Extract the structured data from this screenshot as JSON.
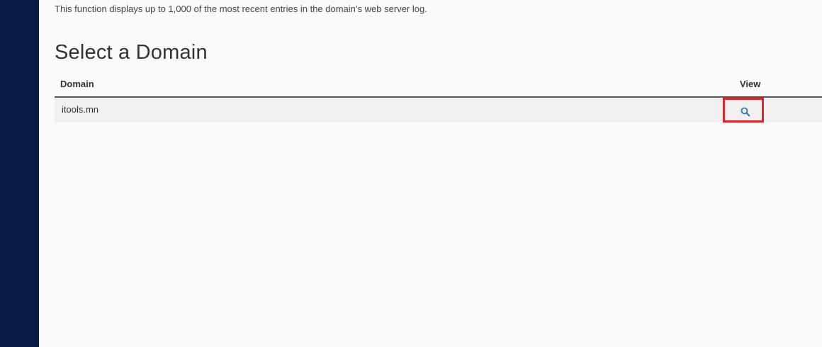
{
  "description": "This function displays up to 1,000 of the most recent entries in the domain’s web server log.",
  "page_title": "Select a Domain",
  "table": {
    "columns": [
      "Domain",
      "View"
    ],
    "rows": [
      {
        "domain": "itools.mn",
        "view_icon": "search-icon"
      }
    ]
  },
  "colors": {
    "sidebar": "#0b1c44",
    "background": "#fafafa",
    "row_background": "#f0f0f0",
    "highlight": "#e0232b",
    "icon": "#3a6fb5"
  }
}
